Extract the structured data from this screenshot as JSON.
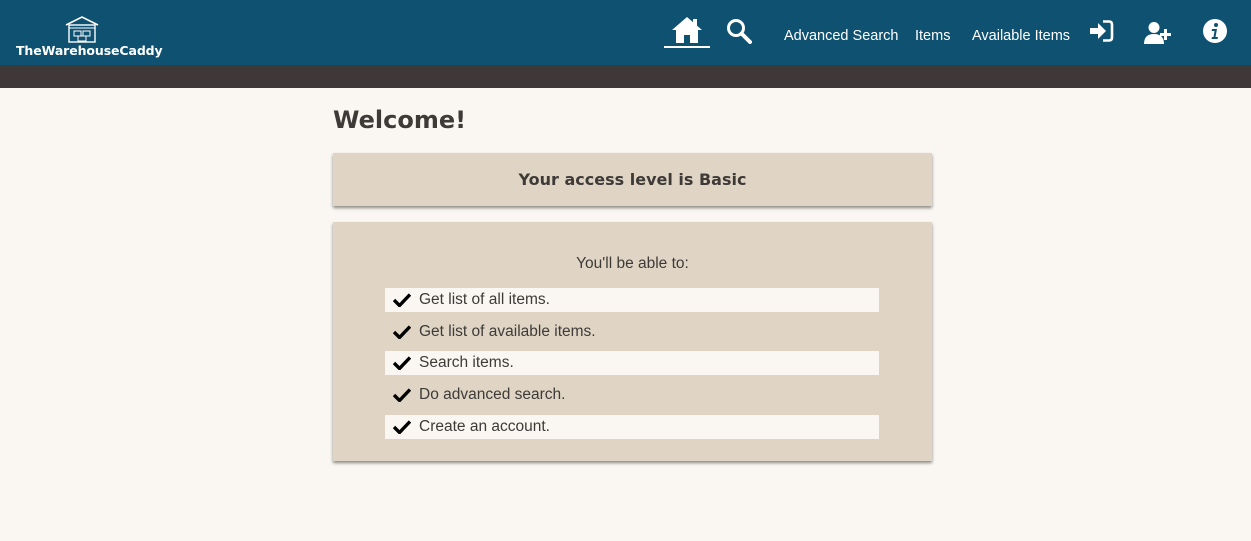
{
  "brand": {
    "name": "TheWarehouseCaddy",
    "logo_icon": "warehouse-icon"
  },
  "nav": {
    "home_icon": "home-icon",
    "search_icon": "search-icon",
    "advanced_search": "Advanced Search",
    "items": "Items",
    "available_items": "Available Items",
    "login_icon": "sign-in-icon",
    "register_icon": "user-plus-icon",
    "info_icon": "info-icon"
  },
  "main": {
    "title": "Welcome!",
    "access_text": "Your access level is Basic",
    "abilities_intro": "You'll be able to:",
    "abilities": [
      "Get list of all items.",
      "Get list of available items.",
      "Search items.",
      "Do advanced search.",
      "Create an account."
    ],
    "check_icon": "check-icon"
  },
  "colors": {
    "navbar": "#0e5170",
    "subbar": "#3e3938",
    "page_bg": "#faf7f2",
    "card_bg": "#e0d5c5",
    "text": "#3d3a38"
  }
}
